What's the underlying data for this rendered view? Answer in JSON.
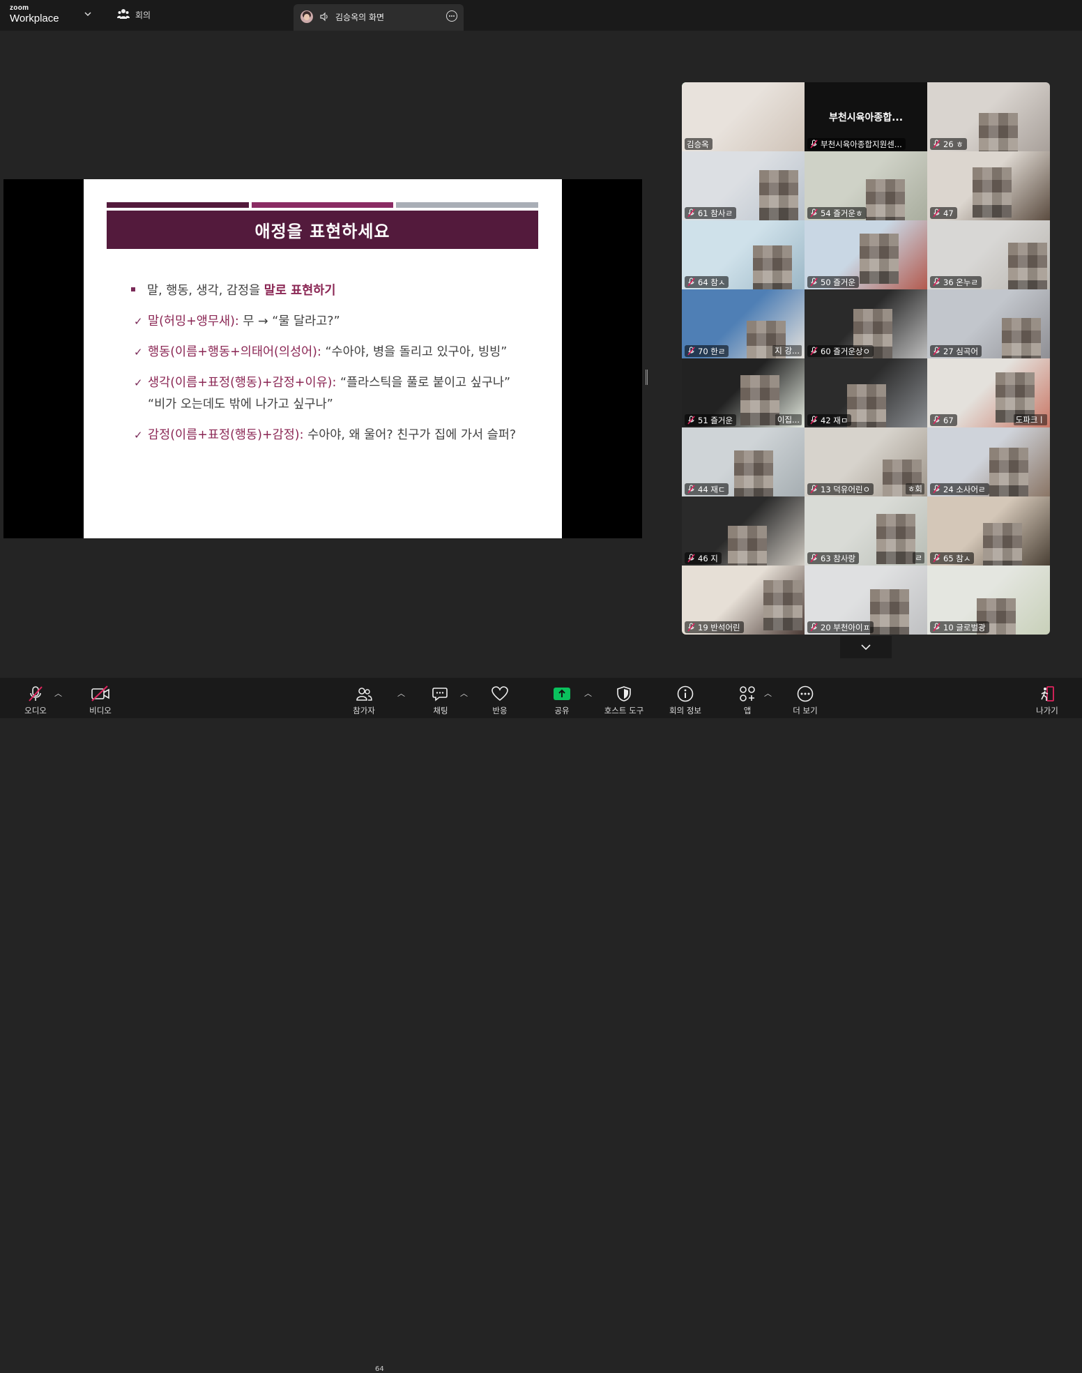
{
  "app": {
    "logo_small": "zoom",
    "logo_big": "Workplace",
    "meeting_tab": "회의"
  },
  "share": {
    "title": "김승옥의 화면"
  },
  "slide": {
    "title": "애정을 표현하세요",
    "bar_colors": [
      "#531a3c",
      "#8a2b63",
      "#a9aeb6"
    ],
    "bullet_prefix": "말, 행동, 생각, 감정을 ",
    "bullet_accent": "말로 표현하기",
    "items": [
      {
        "head": "말(허밍+앵무새):",
        "body": " 무 → “물 달라고?”"
      },
      {
        "head": "행동(이름+행동+의태어(의성어):",
        "body": " “수아야, 병을 돌리고 있구아, 빙빙”"
      },
      {
        "head": "생각(이름+표정(행동)+감정+이유):",
        "body": " “플라스틱을 풀로 붙이고 싶구나”  “비가 오는데도 밖에 나가고 싶구나”"
      },
      {
        "head": "감정(이름+표정(행동)+감정):",
        "body": " 수아야, 왜 울어? 친구가 집에 가서 슬퍼?"
      }
    ]
  },
  "participants": [
    {
      "label": "김승옥",
      "muted": false,
      "active": true
    },
    {
      "label": "부천시육아종합지원센...",
      "muted": true,
      "center_name": "부천시육아종합..."
    },
    {
      "label": "26 ㅎ",
      "muted": true
    },
    {
      "label": "61 참사ㄹ",
      "muted": true
    },
    {
      "label": "54 즐거운ㅎ",
      "muted": true
    },
    {
      "label": "47",
      "muted": true
    },
    {
      "label": "64 참ㅅ",
      "muted": true
    },
    {
      "label": "50 즐거운",
      "muted": true
    },
    {
      "label": "36 온누ㄹ",
      "muted": true
    },
    {
      "label": "70 한ㄹ",
      "muted": true,
      "suffix": "지 강..."
    },
    {
      "label": "60 즐거운상ㅇ",
      "muted": true
    },
    {
      "label": "27 심곡어",
      "muted": true
    },
    {
      "label": "51 즐거운",
      "muted": true,
      "suffix": "이집..."
    },
    {
      "label": "42 재ㅁ",
      "muted": true
    },
    {
      "label": "67",
      "muted": true,
      "suffix": "도파크ㅣ"
    },
    {
      "label": "44 재ㄷ",
      "muted": true
    },
    {
      "label": "13 덕유어린ㅇ",
      "muted": true,
      "suffix": "ㅎ회"
    },
    {
      "label": "24 소사어ㄹ",
      "muted": true
    },
    {
      "label": "46 지",
      "muted": true
    },
    {
      "label": "63 참사랑",
      "muted": true,
      "suffix": "ㄹ"
    },
    {
      "label": "65 참ㅅ",
      "muted": true
    },
    {
      "label": "19 반석어린",
      "muted": true
    },
    {
      "label": "20 부천아이ㅍ",
      "muted": true
    },
    {
      "label": "10 글로벌광",
      "muted": true
    }
  ],
  "toolbar": {
    "audio": "오디오",
    "video": "비디오",
    "participants": "참가자",
    "participants_count": "64",
    "chat": "채팅",
    "reactions": "반응",
    "share": "공유",
    "host_tools": "호스트 도구",
    "meeting_info": "회의 정보",
    "apps": "앱",
    "more": "더 보기",
    "leave": "나가기"
  },
  "colors": {
    "active_border": "#23d17a",
    "share_green": "#0ac15d",
    "muted_red": "#e0245e",
    "slide_accent": "#8a2553"
  }
}
